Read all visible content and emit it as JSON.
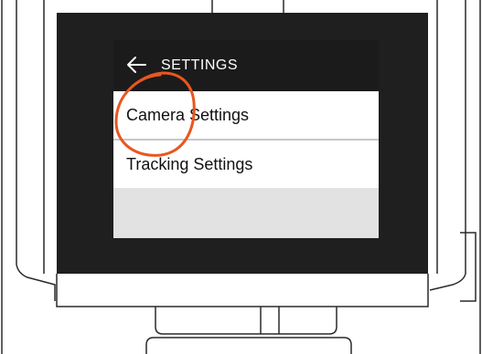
{
  "header": {
    "title": "SETTINGS",
    "back_icon": "arrow-left-icon"
  },
  "menu": {
    "items": [
      {
        "label": "Camera Settings"
      },
      {
        "label": "Tracking Settings"
      }
    ]
  },
  "annotation": {
    "color": "#e8571e",
    "target": "Camera Settings"
  },
  "colors": {
    "header_bg": "#1b1b1b",
    "bezel": "#1f1f1f",
    "outline": "#2a2a2a",
    "empty_area": "#e2e2e2"
  }
}
